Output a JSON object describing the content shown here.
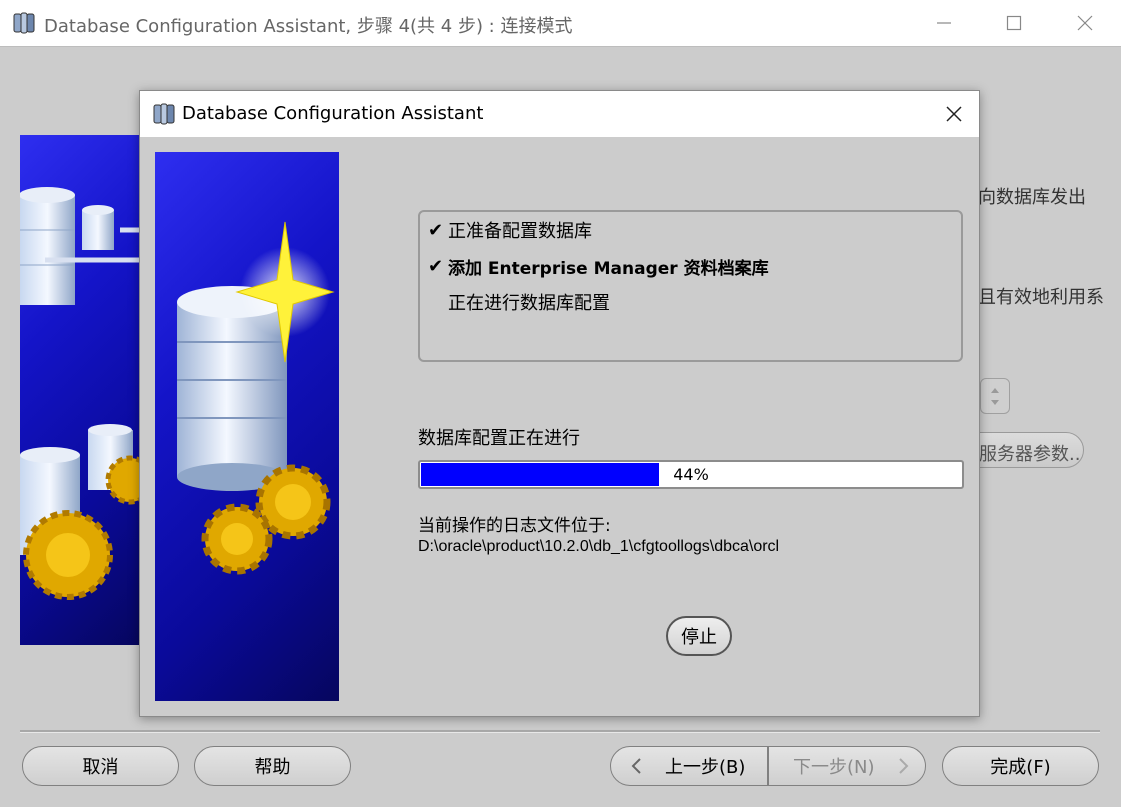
{
  "main_window": {
    "title": "Database Configuration Assistant, 步骤 4(共 4 步) : 连接模式",
    "app_icon": "database-stack-icon",
    "background_text": {
      "line1": "向数据库发出",
      "line2": "且有效地利用系",
      "server_params_button": "服务器参数..."
    },
    "buttons": {
      "cancel": "取消",
      "help": "帮助",
      "back": "上一步(B)",
      "next": "下一步(N)",
      "finish": "完成(F)"
    }
  },
  "dialog": {
    "title": "Database Configuration Assistant",
    "steps": [
      {
        "label": "正准备配置数据库",
        "done": true,
        "bold": false
      },
      {
        "label": "添加 Enterprise Manager 资料档案库",
        "done": true,
        "bold": true
      },
      {
        "label": "正在进行数据库配置",
        "done": false,
        "bold": false
      }
    ],
    "check_glyph": "✔",
    "progress_label": "数据库配置正在进行",
    "progress": {
      "percent": 44,
      "text": "44%"
    },
    "log_label": "当前操作的日志文件位于:",
    "log_path": "D:\\oracle\\product\\10.2.0\\db_1\\cfgtoollogs\\dbca\\orcl",
    "stop_button": "停止"
  },
  "colors": {
    "progress_fill": "#0000ff",
    "window_bg": "#cccccc",
    "titlebar_bg": "#ffffff",
    "art_blue": "#1414c8"
  }
}
